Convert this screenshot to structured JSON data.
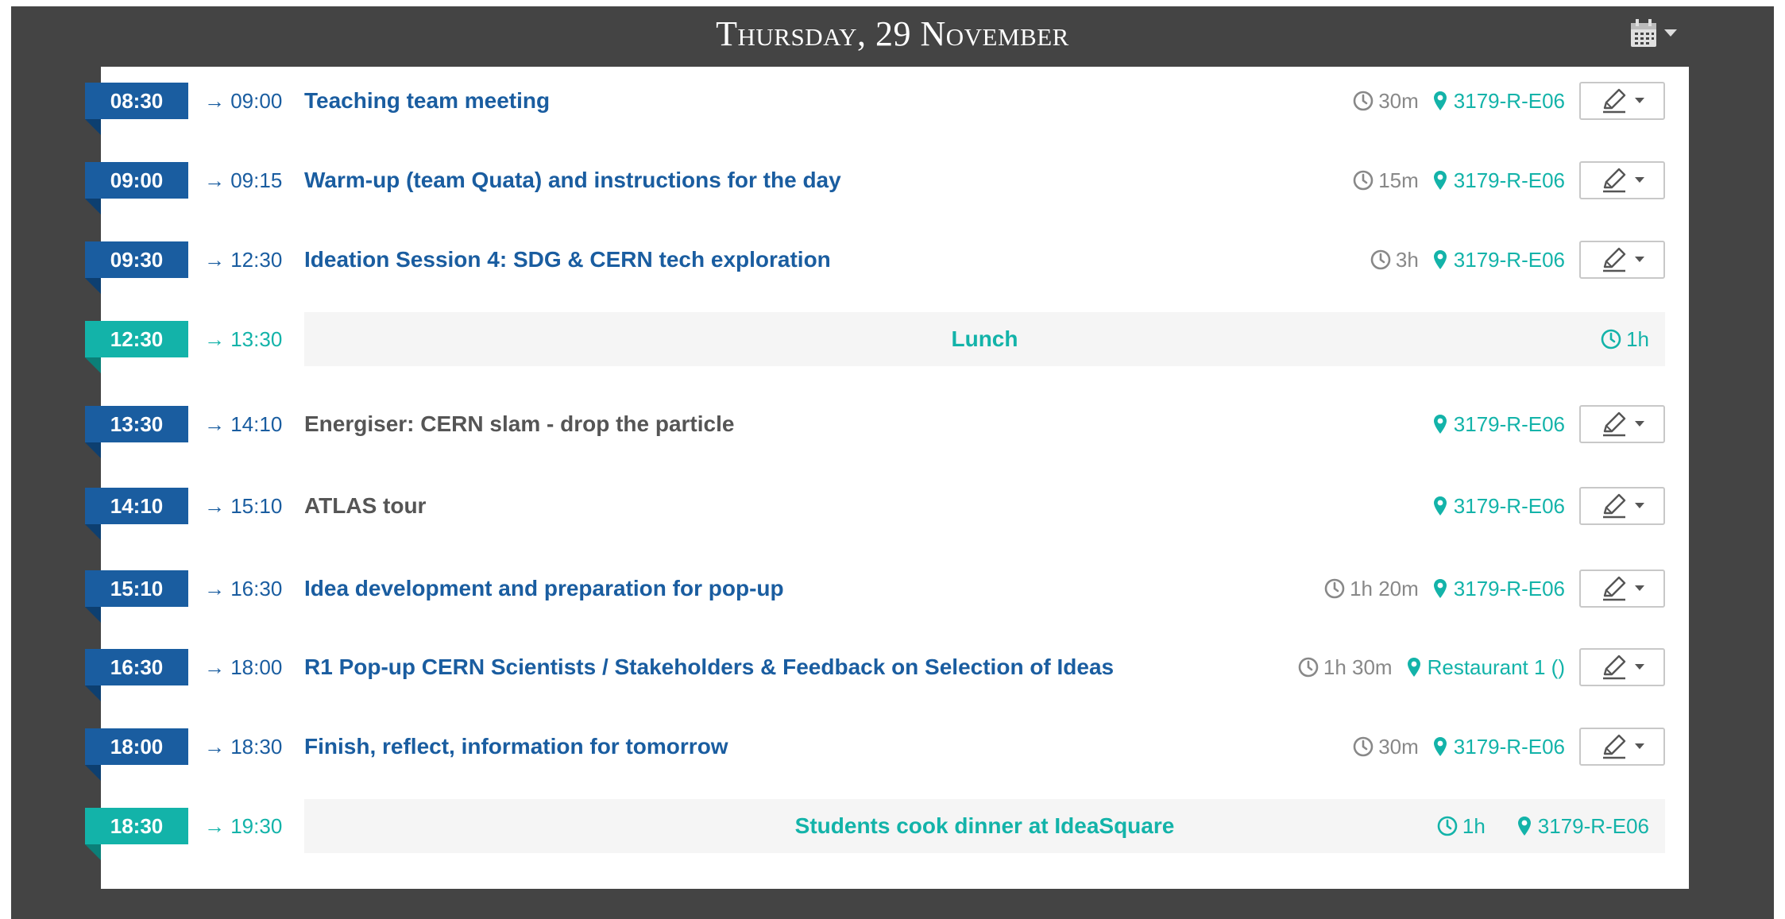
{
  "header": {
    "title": "Thursday, 29 November"
  },
  "icons": {
    "calendar": "calendar-icon",
    "caret": "caret-down-icon",
    "clock": "clock-icon",
    "pin": "map-pin-icon",
    "edit": "pencil-icon"
  },
  "colors": {
    "accent": "#1a5da0",
    "break": "#13b3a9",
    "frame": "#444444"
  },
  "entries": [
    {
      "start": "08:30",
      "end": "→ 09:00",
      "title": "Teaching team meeting",
      "duration": "30m",
      "location": "3179-R-E06",
      "type": "contribution"
    },
    {
      "start": "09:00",
      "end": "→ 09:15",
      "title": "Warm-up (team Quata) and instructions for the day",
      "duration": "15m",
      "location": "3179-R-E06",
      "type": "contribution"
    },
    {
      "start": "09:30",
      "end": "→ 12:30",
      "title": "Ideation Session 4: SDG & CERN tech exploration",
      "duration": "3h",
      "location": "3179-R-E06",
      "type": "contribution"
    },
    {
      "start": "12:30",
      "end": "→ 13:30",
      "title": "Lunch",
      "duration": "1h",
      "location": "",
      "type": "break"
    },
    {
      "start": "13:30",
      "end": "→ 14:10",
      "title": "Energiser: CERN slam - drop the particle",
      "duration": "",
      "location": "3179-R-E06",
      "type": "plain"
    },
    {
      "start": "14:10",
      "end": "→ 15:10",
      "title": "ATLAS tour",
      "duration": "",
      "location": "3179-R-E06",
      "type": "plain"
    },
    {
      "start": "15:10",
      "end": "→ 16:30",
      "title": "Idea development and preparation for pop-up",
      "duration": "1h 20m",
      "location": "3179-R-E06",
      "type": "contribution"
    },
    {
      "start": "16:30",
      "end": "→ 18:00",
      "title": "R1 Pop-up CERN Scientists / Stakeholders & Feedback on Selection of Ideas",
      "duration": "1h 30m",
      "location": "Restaurant 1 ()",
      "type": "contribution"
    },
    {
      "start": "18:00",
      "end": "→ 18:30",
      "title": "Finish, reflect, information for tomorrow",
      "duration": "30m",
      "location": "3179-R-E06",
      "type": "contribution"
    },
    {
      "start": "18:30",
      "end": "→ 19:30",
      "title": "Students cook dinner at IdeaSquare",
      "duration": "1h",
      "location": "3179-R-E06",
      "type": "break"
    }
  ]
}
